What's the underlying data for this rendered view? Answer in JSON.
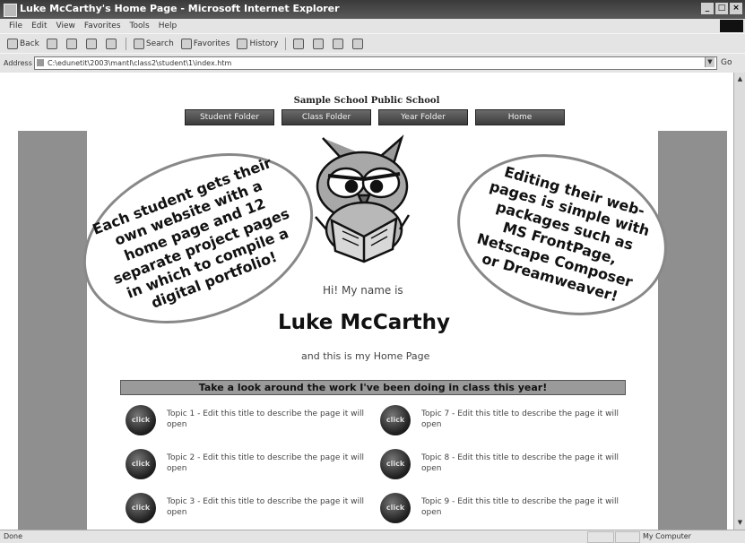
{
  "window": {
    "title": "Luke McCarthy's Home Page - Microsoft Internet Explorer",
    "buttons": [
      "_",
      "□",
      "×"
    ]
  },
  "menu": [
    "File",
    "Edit",
    "View",
    "Favorites",
    "Tools",
    "Help"
  ],
  "toolbar": {
    "back": "Back",
    "search": "Search",
    "favorites": "Favorites",
    "history": "History"
  },
  "address": {
    "label": "Address",
    "url": "C:\\edunetit\\2003\\mantl\\class2\\student\\1\\index.htm",
    "go": "Go"
  },
  "page": {
    "school": "Sample School Public School",
    "nav": [
      "Student Folder",
      "Class Folder",
      "Year Folder",
      "Home"
    ],
    "greeting": "Hi! My name is",
    "name": "Luke McCarthy",
    "tagline": "and this is my Home Page",
    "banner": "Take a look around the work I've been doing in class this year!",
    "disc_label": "click",
    "topics": [
      "Topic 1 - Edit this title to describe the page it will open",
      "Topic 7 - Edit this title to describe the page it will open",
      "Topic 2 - Edit this title to describe the page it will open",
      "Topic 8 - Edit this title to describe the page it will open",
      "Topic 3 - Edit this title to describe the page it will open",
      "Topic 9 - Edit this title to describe the page it will open"
    ]
  },
  "callouts": {
    "left": "Each student gets their own website with a home page and 12 separate project pages in which to compile a digital portfolio!",
    "right": "Editing their web-pages is simple with packages such as MS FrontPage, Netscape Composer or Dreamweaver!"
  },
  "status": {
    "text": "Done",
    "zone": "My Computer"
  },
  "colors": {
    "gutter": "#8f8f8f",
    "banner": "#9a9a9a",
    "callout_border": "#888888"
  }
}
